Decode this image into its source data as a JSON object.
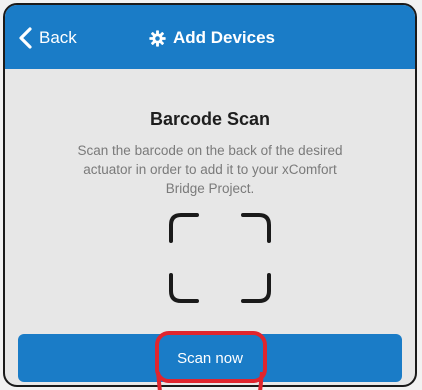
{
  "navbar": {
    "back_label": "Back",
    "title": "Add Devices",
    "back_icon": "chevron-left-icon",
    "title_icon": "gear-icon"
  },
  "main": {
    "heading": "Barcode Scan",
    "description": "Scan the barcode on the back of the desired actuator in order to add it to your xComfort Bridge Project.",
    "scan_icon": "scan-frame-icon",
    "scan_button_label": "Scan now"
  },
  "colors": {
    "brand_blue": "#1a7cc7",
    "background": "#e7e7e7",
    "highlight_red": "#e0252e"
  }
}
